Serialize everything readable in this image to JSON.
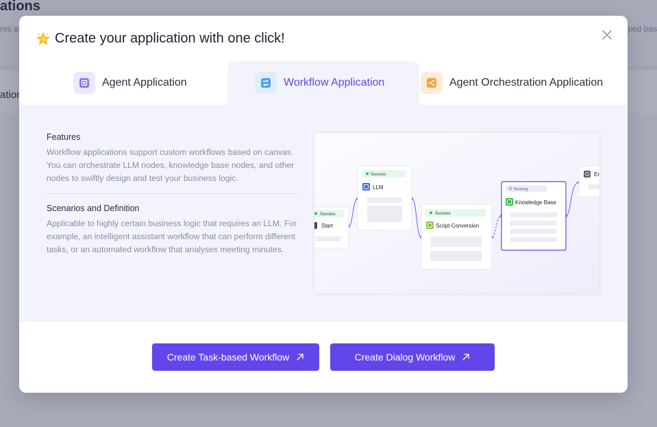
{
  "background": {
    "title": "ations",
    "desc_left": "res as",
    "desc_right": "ped bas",
    "band_text": "ation"
  },
  "modal": {
    "title": "Create your application with one click!",
    "title_icon": "star-icon",
    "close_icon": "close-icon"
  },
  "tabs": [
    {
      "label": "Agent Application",
      "icon": "agent-icon",
      "active": false
    },
    {
      "label": "Workflow Application",
      "icon": "workflow-icon",
      "active": true
    },
    {
      "label": "Agent Orchestration Application",
      "icon": "orchestration-icon",
      "active": false
    }
  ],
  "features": {
    "title": "Features",
    "text": "Workflow applications support custom workflows based on canvas. You can orchestrate LLM nodes, knowledge base nodes, and other nodes to swiftly design and test your business logic."
  },
  "scenarios": {
    "title": "Scenarios and Definition",
    "text": "Applicable to highly certain business logic that requires an LLM. For example, an intelligent assistant workflow that can perform different tasks, or an automated workflow that analyses meeting minutes."
  },
  "preview": {
    "nodes": {
      "start": {
        "status": "Success",
        "label": "Start"
      },
      "llm": {
        "status": "Success",
        "label": "LLM"
      },
      "script": {
        "status": "Success",
        "label": "Script Conversion"
      },
      "kb": {
        "status": "Running",
        "label": "Knowledge Base"
      },
      "end": {
        "label": "Er"
      }
    }
  },
  "buttons": {
    "task": "Create Task-based Workflow",
    "dialog": "Create Dialog Workflow"
  },
  "colors": {
    "accent": "#6246ea",
    "success": "#23c55e",
    "running": "#7a6cf0"
  }
}
